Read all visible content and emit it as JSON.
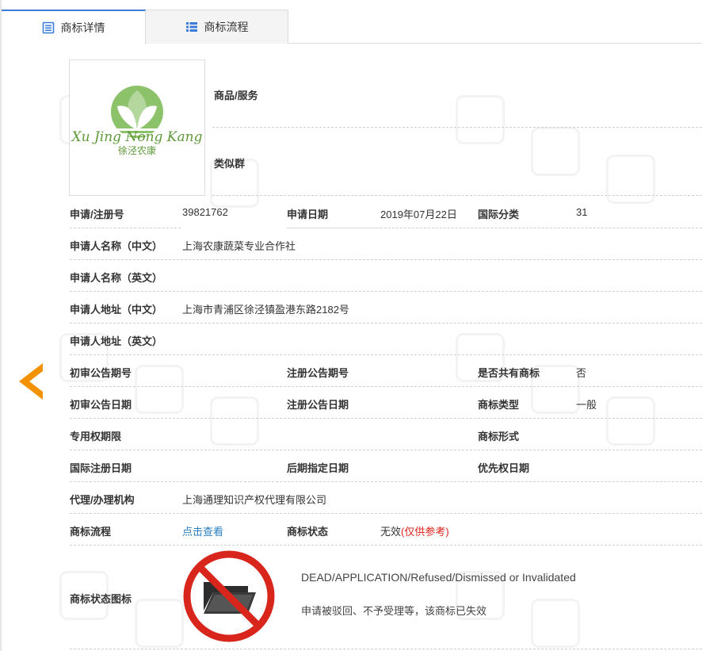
{
  "tabs": [
    {
      "label": "商标详情",
      "active": true
    },
    {
      "label": "商标流程",
      "active": false
    }
  ],
  "logo": {
    "text_latin": "Xu Jing Nong Kang",
    "text_cn": "徐泾农康"
  },
  "goods": {
    "label": "商品/服务",
    "value": ""
  },
  "similar_group": {
    "label": "类似群",
    "value": ""
  },
  "rows": {
    "reg_no": {
      "label": "申请/注册号",
      "value": "39821762"
    },
    "apply_date": {
      "label": "申请日期",
      "value": "2019年07月22日"
    },
    "intl_class": {
      "label": "国际分类",
      "value": "31"
    },
    "applicant_cn": {
      "label": "申请人名称（中文）",
      "value": "上海农康蔬菜专业合作社"
    },
    "applicant_en": {
      "label": "申请人名称（英文）",
      "value": ""
    },
    "address_cn": {
      "label": "申请人地址（中文）",
      "value": "上海市青浦区徐泾镇盈港东路2182号"
    },
    "address_en": {
      "label": "申请人地址（英文）",
      "value": ""
    },
    "prelim_issue": {
      "label": "初审公告期号",
      "value": ""
    },
    "reg_issue": {
      "label": "注册公告期号",
      "value": ""
    },
    "shared": {
      "label": "是否共有商标",
      "value": "否"
    },
    "prelim_date": {
      "label": "初审公告日期",
      "value": ""
    },
    "reg_date": {
      "label": "注册公告日期",
      "value": ""
    },
    "tm_type": {
      "label": "商标类型",
      "value": "一般"
    },
    "exclusive_period": {
      "label": "专用权期限",
      "value": ""
    },
    "tm_form": {
      "label": "商标形式",
      "value": ""
    },
    "intl_reg_date": {
      "label": "国际注册日期",
      "value": ""
    },
    "later_designation": {
      "label": "后期指定日期",
      "value": ""
    },
    "priority_date": {
      "label": "优先权日期",
      "value": ""
    },
    "agent": {
      "label": "代理/办理机构",
      "value": "上海通理知识产权代理有限公司"
    },
    "flow": {
      "label": "商标流程",
      "link": "点击查看"
    },
    "status": {
      "label": "商标状态",
      "value": "无效",
      "note": "(仅供参考)"
    },
    "status_icon": {
      "label": "商标状态图标",
      "line1": "DEAD/APPLICATION/Refused/Dismissed or Invalidated",
      "line2": "申请被驳回、不予受理等，该商标已失效"
    }
  },
  "colors": {
    "accent": "#3b7dd8",
    "link": "#2a7fc1",
    "status_red": "#e0211b",
    "arrow": "#f39200",
    "prohibit": "#d9261c"
  },
  "icons": {
    "tab_detail": "document-list-icon",
    "tab_flow": "list-icon",
    "prev": "chevron-left-icon",
    "status": "dead-folder-icon"
  }
}
